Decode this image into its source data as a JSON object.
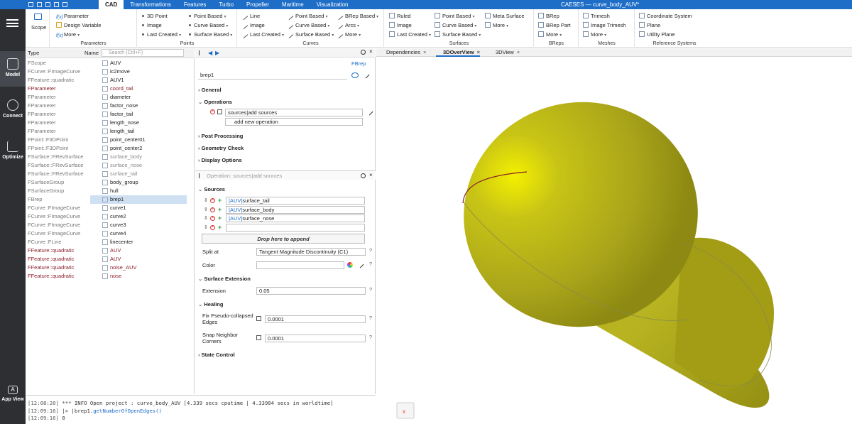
{
  "app": {
    "title": "CAESES  —  curve_body_AUV*",
    "accent": "#1e6ec8"
  },
  "menubar": {
    "tabs": [
      "CAD",
      "Transformations",
      "Features",
      "Turbo",
      "Propeller",
      "Maritime",
      "Visualization"
    ],
    "active": "CAD"
  },
  "ribbon": {
    "scope": "Scope",
    "parameters": {
      "title": "Parameters",
      "items": [
        "Parameter",
        "Design Variable",
        "More"
      ]
    },
    "points": {
      "title": "Points",
      "items": [
        "3D Point",
        "Image",
        "Last Created",
        "Point Based",
        "Curve Based",
        "Surface Based"
      ]
    },
    "curves": {
      "title": "Curves",
      "items": [
        "Line",
        "Image",
        "Last Created",
        "Point Based",
        "Curve Based",
        "Surface Based",
        "BRep Based",
        "Arcs",
        "More"
      ]
    },
    "surfaces": {
      "title": "Surfaces",
      "items": [
        "Ruled",
        "Image",
        "Last Created",
        "Point Based",
        "Curve Based",
        "Surface Based",
        "Meta Surface",
        "More"
      ]
    },
    "breps": {
      "title": "BReps",
      "items": [
        "BRep",
        "BRep Part",
        "More"
      ]
    },
    "meshes": {
      "title": "Meshes",
      "items": [
        "Trimesh",
        "Image Trimesh",
        "More"
      ]
    },
    "refsys": {
      "title": "Reference Systems",
      "items": [
        "Coordinate System",
        "Plane",
        "Utility Plane"
      ]
    }
  },
  "leftnav": {
    "items": [
      "Model",
      "Connect",
      "Optimize"
    ],
    "bottom": "App View",
    "bottom_glyph": "A"
  },
  "tree": {
    "col_type": "Type",
    "col_name": "Name",
    "search_placeholder": "Search (Ctrl+F)",
    "rows": [
      {
        "type": "FScope",
        "name": "AUV",
        "style": ""
      },
      {
        "type": "FCurve::FImageCurve",
        "name": "ic2move",
        "style": ""
      },
      {
        "type": "FFeature::quadratic",
        "name": "AUV1",
        "style": ""
      },
      {
        "type": "FParameter",
        "name": "coord_tail",
        "style": "red"
      },
      {
        "type": "FParameter",
        "name": "diameter",
        "style": ""
      },
      {
        "type": "FParameter",
        "name": "factor_nose",
        "style": ""
      },
      {
        "type": "FParameter",
        "name": "factor_tail",
        "style": ""
      },
      {
        "type": "FParameter",
        "name": "length_nose",
        "style": ""
      },
      {
        "type": "FParameter",
        "name": "length_tail",
        "style": ""
      },
      {
        "type": "FPoint::F3DPoint",
        "name": "point_center01",
        "style": ""
      },
      {
        "type": "FPoint::F3DPoint",
        "name": "point_center2",
        "style": ""
      },
      {
        "type": "FSurface::FRevSurface",
        "name": "surface_body",
        "style": "dim"
      },
      {
        "type": "FSurface::FRevSurface",
        "name": "surface_nose",
        "style": "dim"
      },
      {
        "type": "FSurface::FRevSurface",
        "name": "surface_tail",
        "style": "dim"
      },
      {
        "type": "FSurfaceGroup",
        "name": "body_group",
        "style": ""
      },
      {
        "type": "FSurfaceGroup",
        "name": "hull",
        "style": ""
      },
      {
        "type": "FBrep",
        "name": "brep1",
        "style": "sel"
      },
      {
        "type": "FCurve::FImageCurve",
        "name": "curve1",
        "style": ""
      },
      {
        "type": "FCurve::FImageCurve",
        "name": "curve2",
        "style": ""
      },
      {
        "type": "FCurve::FImageCurve",
        "name": "curve3",
        "style": ""
      },
      {
        "type": "FCurve::FImageCurve",
        "name": "curve4",
        "style": ""
      },
      {
        "type": "FCurve::FLine",
        "name": "linecenter",
        "style": ""
      },
      {
        "type": "FFeature::quadratic",
        "name": "AUV",
        "style": "red"
      },
      {
        "type": "FFeature::quadratic",
        "name": "AUV",
        "style": "red"
      },
      {
        "type": "FFeature::quadratic",
        "name": "noise_AUV",
        "style": "red"
      },
      {
        "type": "FFeature::quadratic",
        "name": "nose",
        "style": "red"
      }
    ]
  },
  "props": {
    "type_label": "FBrep",
    "name": "brep1",
    "sections": [
      "General",
      "Operations",
      "Post Processing",
      "Geometry Check",
      "Display Options"
    ],
    "operation_value": "sources|add sources",
    "add_operation": "add new operation",
    "op_header": "Operation: sources|add sources",
    "sources_title": "Sources",
    "sources": [
      {
        "scope": "|AUV|",
        "name": "surface_tail"
      },
      {
        "scope": "|AUV|",
        "name": "surface_body"
      },
      {
        "scope": "|AUV|",
        "name": "surface_nose"
      }
    ],
    "drop_label": "Drop here to append",
    "split_label": "Split at",
    "split_value": "Tangent Magnitude Discontinuity (C1)",
    "color_label": "Color",
    "ext_title": "Surface Extension",
    "ext_label": "Extension",
    "ext_value": "0.05",
    "heal_title": "Healing",
    "fix_label": "Fix Pseudo-collapsed Edges",
    "fix_value": "0.0001",
    "snap_label": "Snap Neighbor Corners",
    "snap_value": "0.0001",
    "state_title": "State Control"
  },
  "viewtabs": {
    "tabs": [
      "Dependencies",
      "3DOverView",
      "3DView"
    ],
    "active": "3DOverView"
  },
  "console": {
    "lines": [
      {
        "ts": "[12:08:20]",
        "text": " *** INFO Open project : curve_body_AUV [4.339 secs cputime | 4.33904 secs in worldtime]"
      },
      {
        "ts": "[12:09:16]",
        "text": " |> |brep1.",
        "kw": "getNumberOfOpenEdges()"
      },
      {
        "ts": "[12:09:16]",
        "text": " 0"
      }
    ]
  },
  "colors": {
    "body": "#a9a41a",
    "highlight": "#f4f000",
    "seam": "#8a1f2a"
  }
}
